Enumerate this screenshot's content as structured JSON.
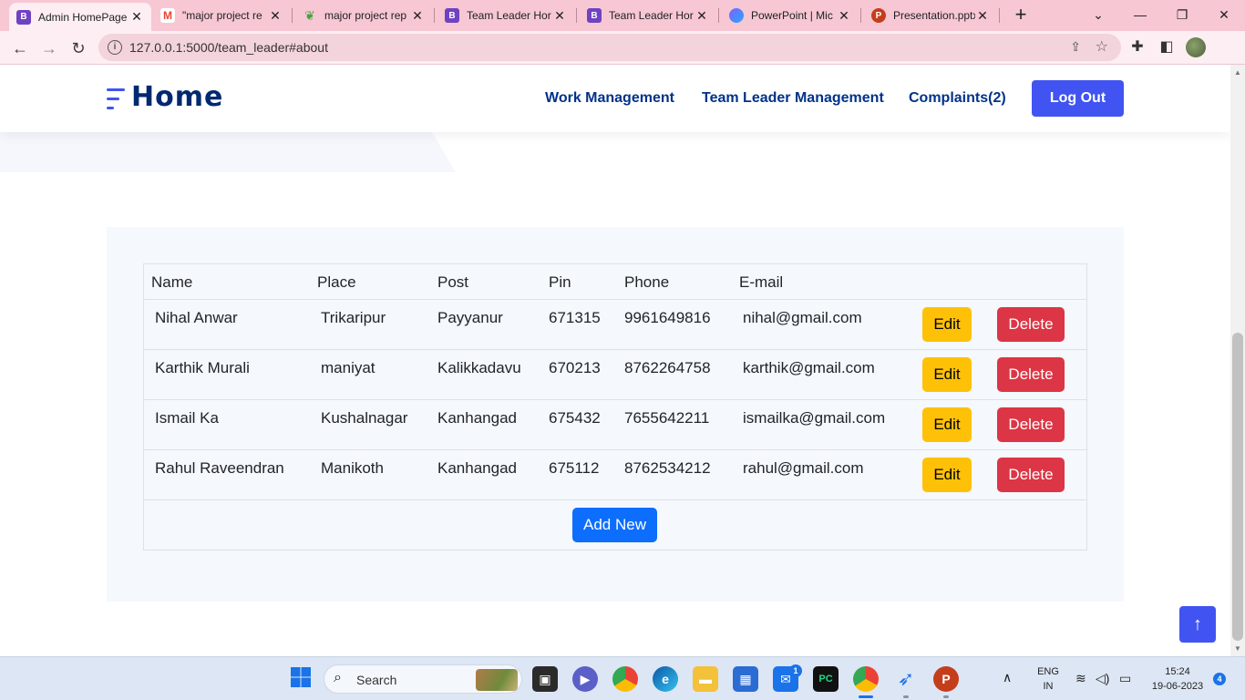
{
  "browser": {
    "tabs": [
      {
        "title": "Admin HomePage",
        "icon": "bootstrap-icon",
        "active": true
      },
      {
        "title": "\"major project re",
        "icon": "gmail-icon",
        "active": false
      },
      {
        "title": "major project rep",
        "icon": "overleaf-icon",
        "active": false
      },
      {
        "title": "Team Leader Hor",
        "icon": "bootstrap-icon",
        "active": false
      },
      {
        "title": "Team Leader Hor",
        "icon": "bootstrap-icon",
        "active": false
      },
      {
        "title": "PowerPoint | Mic",
        "icon": "microsoft365-icon",
        "active": false
      },
      {
        "title": "Presentation.pptx",
        "icon": "powerpoint-icon",
        "active": false
      }
    ],
    "url": "127.0.0.1:5000/team_leader#about"
  },
  "header": {
    "logo": "Home",
    "nav": [
      "Work Management",
      "Team Leader Management",
      "Complaints(2)"
    ],
    "logout_label": "Log Out"
  },
  "table": {
    "columns": [
      "Name",
      "Place",
      "Post",
      "Pin",
      "Phone",
      "E-mail"
    ],
    "rows": [
      {
        "name": "Nihal Anwar",
        "place": "Trikaripur",
        "post": "Payyanur",
        "pin": "671315",
        "phone": "9961649816",
        "email": "nihal@gmail.com"
      },
      {
        "name": "Karthik Murali",
        "place": "maniyat",
        "post": "Kalikkadavu",
        "pin": "670213",
        "phone": "8762264758",
        "email": "karthik@gmail.com"
      },
      {
        "name": "Ismail Ka",
        "place": "Kushalnagar",
        "post": "Kanhangad",
        "pin": "675432",
        "phone": "7655642211",
        "email": "ismailka@gmail.com"
      },
      {
        "name": "Rahul Raveendran",
        "place": "Manikoth",
        "post": "Kanhangad",
        "pin": "675112",
        "phone": "8762534212",
        "email": "rahul@gmail.com"
      }
    ],
    "edit_label": "Edit",
    "delete_label": "Delete",
    "add_label": "Add New"
  },
  "taskbar": {
    "search_label": "Search",
    "lang": "ENG",
    "region": "IN",
    "time": "15:24",
    "date": "19-06-2023",
    "mail_badge": "1",
    "notification_count": "4"
  },
  "colors": {
    "primary": "#4154f1",
    "nav_text": "#013289",
    "edit": "#ffc107",
    "delete": "#dc3545",
    "add": "#0d6efd"
  }
}
